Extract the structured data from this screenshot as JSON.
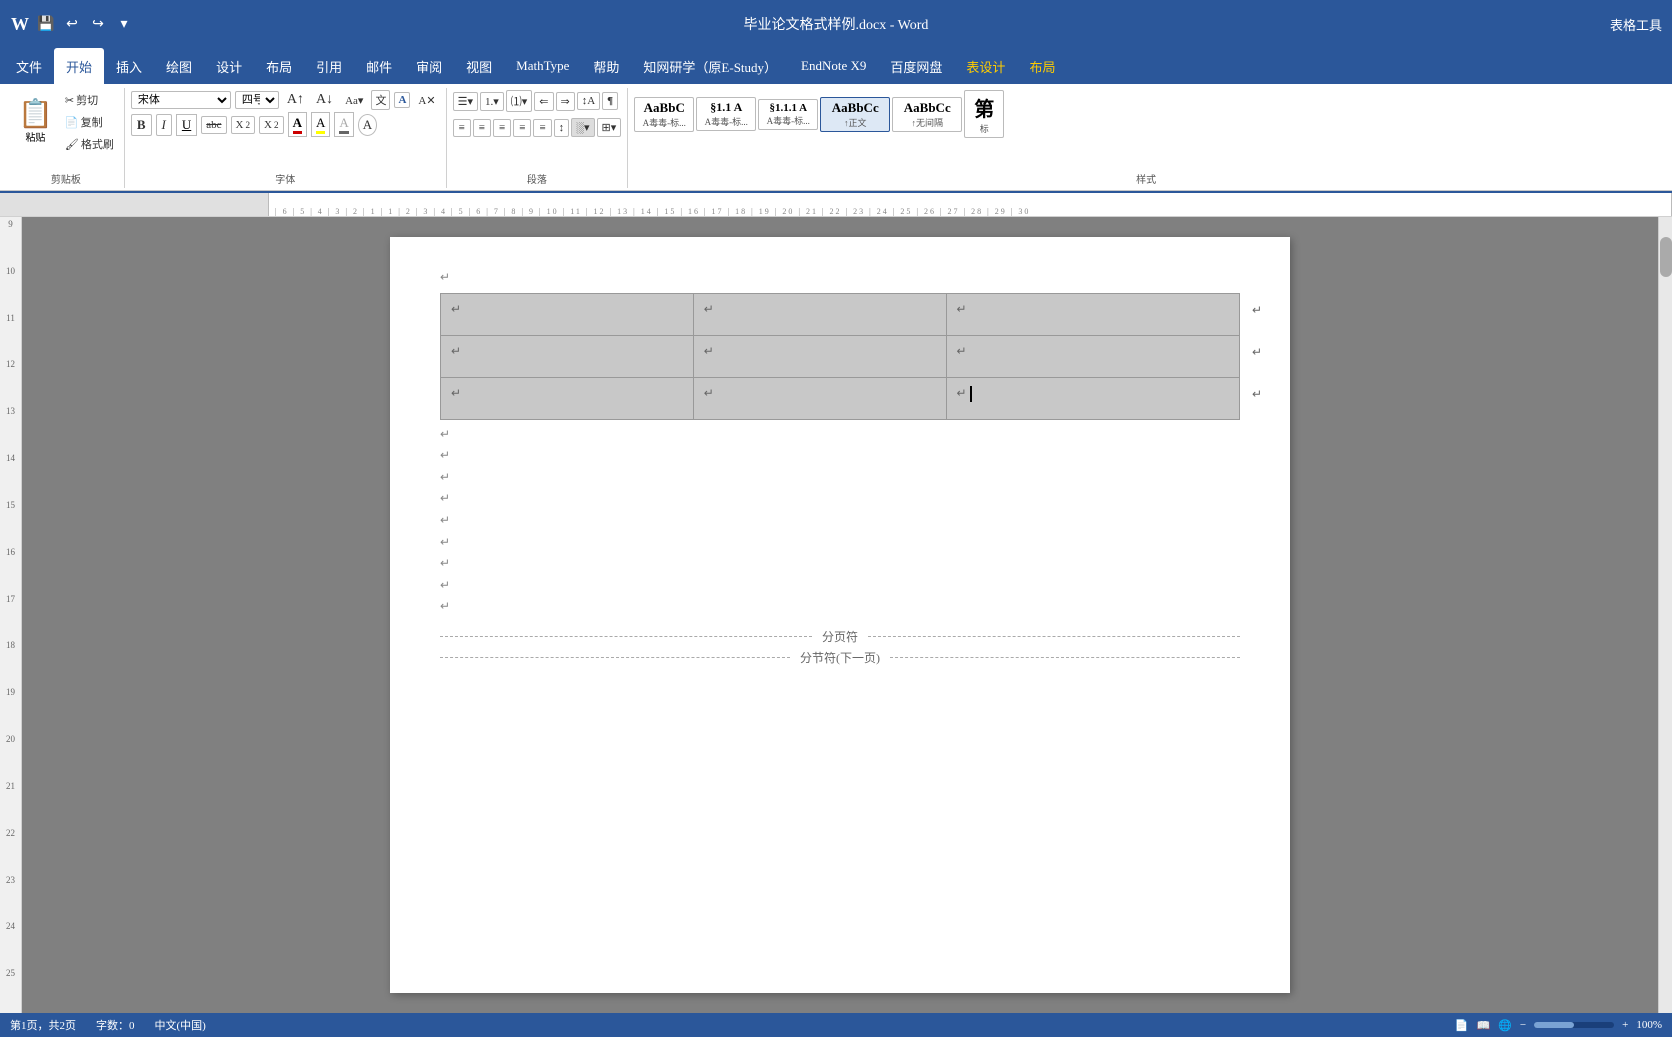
{
  "titleBar": {
    "filename": "毕业论文格式样例.docx",
    "appName": "Word",
    "fullTitle": "毕业论文格式样例.docx - Word",
    "tableTools": "表格工具",
    "qat": [
      "save",
      "undo",
      "redo",
      "customize"
    ]
  },
  "ribbon": {
    "tabs": [
      "文件",
      "开始",
      "插入",
      "绘图",
      "设计",
      "布局",
      "引用",
      "邮件",
      "审阅",
      "视图",
      "MathType",
      "帮助",
      "知网研学（原E-Study）",
      "EndNote X9",
      "百度网盘",
      "表设计",
      "布局"
    ],
    "activeTab": "开始",
    "groups": {
      "clipboard": {
        "label": "剪贴板",
        "paste": "粘贴",
        "cut": "剪切",
        "copy": "复制",
        "formatPainter": "格式刷"
      },
      "font": {
        "label": "字体",
        "fontName": "宋体",
        "fontSize": "四号",
        "bold": "B",
        "italic": "I",
        "underline": "U",
        "strikethrough": "abc",
        "subscript": "X₂",
        "superscript": "X²",
        "fontColor": "A",
        "highlight": "A",
        "clearFormat": "A"
      },
      "paragraph": {
        "label": "段落"
      },
      "styles": {
        "label": "样式",
        "items": [
          {
            "name": "normal",
            "preview": "AaBbC",
            "label": "A毒毒-标..."
          },
          {
            "name": "heading1",
            "preview": "§1.1 A",
            "label": "A毒毒-标..."
          },
          {
            "name": "heading11",
            "preview": "§1.1.1 A",
            "label": "A毒毒-标..."
          },
          {
            "name": "normal2",
            "preview": "AaBbCc",
            "label": "↑正文"
          },
          {
            "name": "nospacing",
            "preview": "AaBbCc",
            "label": "↑无间隔"
          },
          {
            "name": "heading",
            "preview": "第",
            "label": "标"
          }
        ]
      }
    }
  },
  "document": {
    "tableCells": [
      [
        "↵",
        "↵",
        "↵"
      ],
      [
        "↵",
        "↵",
        "↵"
      ],
      [
        "↵",
        "↵",
        "↵"
      ]
    ],
    "paragraphMarks": [
      "↵",
      "↵",
      "↵",
      "↵",
      "↵",
      "↵",
      "↵",
      "↵",
      "↵"
    ],
    "pageBreakLabel": "分页符",
    "sectionBreakLabel": "分节符(下一页)"
  },
  "statusBar": {
    "pageInfo": "第1页，共2页",
    "wordCount": "字数：0",
    "language": "中文(中国)",
    "zoom": "100%"
  },
  "ruler": {
    "leftNumbers": [
      "9",
      "10",
      "11",
      "12",
      "13",
      "14",
      "15",
      "16",
      "17",
      "18",
      "19",
      "20",
      "21",
      "22",
      "23",
      "24",
      "25"
    ]
  }
}
